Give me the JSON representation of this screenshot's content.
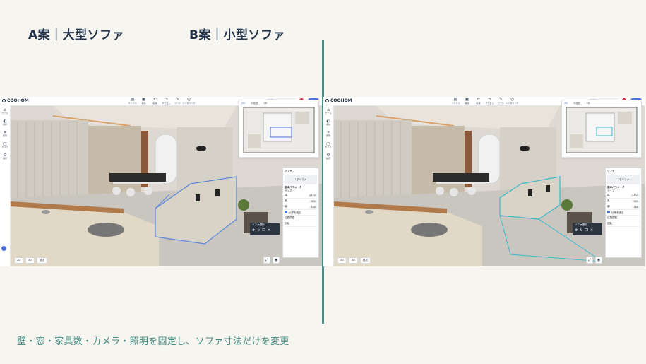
{
  "headings": {
    "a": "A案｜大型ソファ",
    "b": "B案｜小型ソファ"
  },
  "caption": "壁・窓・家具数・カメラ・照明を固定し、ソファ寸法だけを変更",
  "app": {
    "logo": "COOHOM",
    "toolbar": [
      {
        "label": "ファイル",
        "icon": "file-icon"
      },
      {
        "label": "保存",
        "icon": "save-icon"
      },
      {
        "label": "取消",
        "icon": "undo-icon"
      },
      {
        "label": "やり直し",
        "icon": "redo-icon"
      },
      {
        "label": "ツール",
        "icon": "tool-icon"
      },
      {
        "label": "レンダリング",
        "icon": "render-icon"
      }
    ],
    "search_placeholder": "検索",
    "plan_button": "プラン",
    "sidebar": [
      {
        "label": "モデル",
        "icon": "model-icon"
      },
      {
        "label": "素材",
        "icon": "material-icon"
      },
      {
        "label": "照明",
        "icon": "light-icon"
      },
      {
        "label": "カメラ",
        "icon": "camera-icon"
      },
      {
        "label": "設定",
        "icon": "settings-icon"
      }
    ],
    "minimap_tabs": [
      "2D",
      "平面図",
      "3D"
    ],
    "panel": {
      "title": "ソファ",
      "item": "L字ソファ",
      "section": "基本パラメータ",
      "size_label": "サイズ",
      "rows": [
        {
          "label": "幅",
          "value": "2400"
        },
        {
          "label": "奥",
          "value": "960"
        },
        {
          "label": "高",
          "value": "780"
        }
      ],
      "option1": "比率を固定",
      "option2": "位置調整",
      "option3": "回転"
    },
    "selection_toolbar": "ソファ選択",
    "bottom_controls": [
      "2D",
      "3D",
      "視点"
    ]
  }
}
